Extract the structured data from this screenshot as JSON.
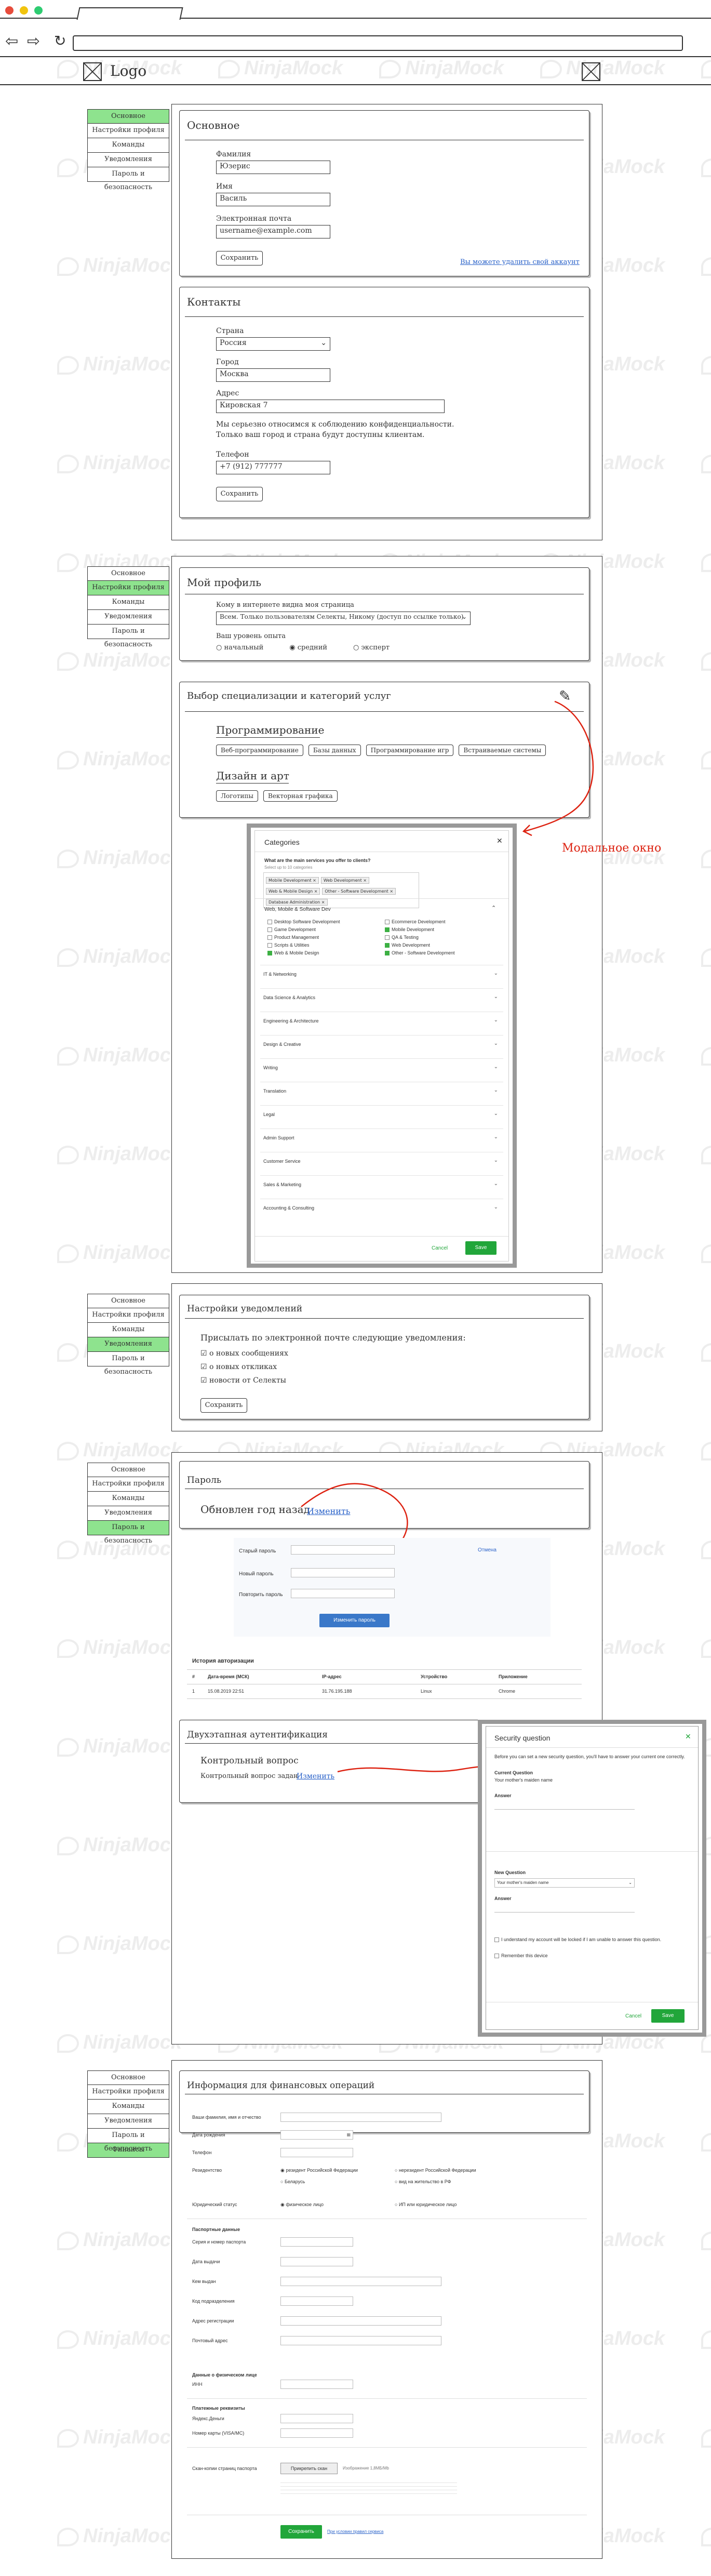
{
  "browser": {
    "logo": "Logo"
  },
  "watermark": "NinjaMock",
  "sidebar": [
    "Основное",
    "Настройки профиля",
    "Команды",
    "Уведомления",
    "Пароль и безопасность"
  ],
  "sidebar_finance": [
    "Основное",
    "Настройки профиля",
    "Команды",
    "Уведомления",
    "Пароль и безопасность",
    "Финансы"
  ],
  "basic": {
    "title": "Основное",
    "lastname_label": "Фамилия",
    "lastname": "Юзерис",
    "firstname_label": "Имя",
    "firstname": "Василь",
    "email_label": "Электронная почта",
    "email": "username@example.com",
    "save": "Сохранить",
    "delete_link": "Вы можете удалить свой аккаунт"
  },
  "contacts": {
    "title": "Контакты",
    "country_label": "Страна",
    "country": "Россия",
    "city_label": "Город",
    "city": "Москва",
    "address_label": "Адрес",
    "address": "Кировская 7",
    "note": "Мы серьезно относимся к соблюдению конфиденциальности. Только ваш город и страна будут доступны клиентам.",
    "phone_label": "Телефон",
    "phone": "+7 (912) 777777",
    "save": "Сохранить"
  },
  "profile": {
    "title": "Мой профиль",
    "visible_label": "Кому в интернете видна моя страница",
    "visible_value": "Всем. Только пользователям Селекты, Никому (доступ по ссылке только)",
    "exp_label": "Ваш уровень опыта",
    "exp": [
      "начальный",
      "средний",
      "эксперт"
    ]
  },
  "services": {
    "title": "Выбор специализации и категорий услуг",
    "cat1": "Программирование",
    "tags1": [
      "Веб-программирование",
      "Базы данных",
      "Программирование игр",
      "Встраиваемые системы"
    ],
    "cat2": "Дизайн и арт",
    "tags2": [
      "Логотипы",
      "Векторная графика"
    ],
    "modal_note": "Модальное окно"
  },
  "categories_modal": {
    "title": "Categories",
    "question": "What are the main services you offer to clients?",
    "hint": "Select up to 10 categories",
    "chips": [
      "Mobile Development ×",
      "Web Development ×",
      "Web & Mobile Design ×",
      "Other - Software Development ×",
      "Database Administration ×"
    ],
    "group": "Web, Mobile & Software Dev",
    "left": [
      "Desktop Software Development",
      "Game Development",
      "Product Management",
      "Scripts & Utilities",
      "Web & Mobile Design"
    ],
    "right": [
      "Ecommerce Development",
      "Mobile Development",
      "QA & Testing",
      "Web Development",
      "Other - Software Development"
    ],
    "rows": [
      "IT & Networking",
      "Data Science & Analytics",
      "Engineering & Architecture",
      "Design & Creative",
      "Writing",
      "Translation",
      "Legal",
      "Admin Support",
      "Customer Service",
      "Sales & Marketing",
      "Accounting & Consulting"
    ],
    "cancel": "Cancel",
    "save": "Save"
  },
  "notifications": {
    "title": "Настройки уведомлений",
    "lead": "Присылать по электронной почте следующие уведомления:",
    "items": [
      "о новых сообщениях",
      "о новых откликах",
      "новости от Селекты"
    ],
    "save": "Сохранить"
  },
  "password": {
    "title": "Пароль",
    "changed": "Обновлен год назад",
    "change": "Изменить",
    "old": "Старый пароль",
    "cancel": "Отмена",
    "new": "Новый пароль",
    "repeat": "Повторить пароль",
    "submit": "Изменить пароль"
  },
  "history": {
    "title": "История авторизации",
    "headers": [
      "#",
      "Дата-время (МСК)",
      "IP-адрес",
      "Устройство",
      "Приложение"
    ],
    "row": [
      "1",
      "15.08.2019 22:51",
      "31.76.195.188",
      "Linux",
      "Chrome"
    ]
  },
  "twofa": {
    "title": "Двухэтапная аутентификация",
    "subtitle": "Контрольный вопрос",
    "desc": "Контрольный вопрос задан",
    "change": "Изменить"
  },
  "security_modal": {
    "title": "Security question",
    "intro": "Before you can set a new security question, you'll have to answer your current one correctly.",
    "current_label": "Current Question",
    "current": "Your mother's maiden name",
    "answer": "Answer",
    "new_label": "New Question",
    "new_value": "Your mother's maiden name",
    "answer2": "Answer",
    "cb1": "I understand my account will be locked if I am unable to answer this question.",
    "cb2": "Remember this device",
    "cancel": "Cancel",
    "save": "Save"
  },
  "finance": {
    "title": "Информация для финансовых операций",
    "fields": [
      "Ваши фамилия, имя и отчество",
      "Дата рождения",
      "Телефон",
      "Резидентство",
      "",
      "Юридический статус"
    ],
    "resid": [
      "резидент Российской Федерации",
      "нерезидент Российской Федерации",
      "Беларусь",
      "вид на жительство в РФ"
    ],
    "status": [
      "физическое лицо",
      "ИП или юридическое лицо"
    ],
    "passport_title": "Паспортные данные",
    "passport": [
      "Серия и номер паспорта",
      "Дата выдачи",
      "Кем выдан",
      "Код подразделения",
      "Адрес регистрации",
      "Почтовый адрес"
    ],
    "inn_title": "Данные о физическом лице",
    "inn": "ИНН",
    "wallets_title": "Платежные реквизиты",
    "wallets": [
      "Яндекс.Деньги",
      "Номер карты (VISA/MC)"
    ],
    "scan": "Скан-копии страниц паспорта",
    "scan_btn": "Прикрепить скан",
    "scan_note": "Изображение 1,8МБ/Mb",
    "save": "Сохранить",
    "terms": "При условии правил сервиса"
  }
}
